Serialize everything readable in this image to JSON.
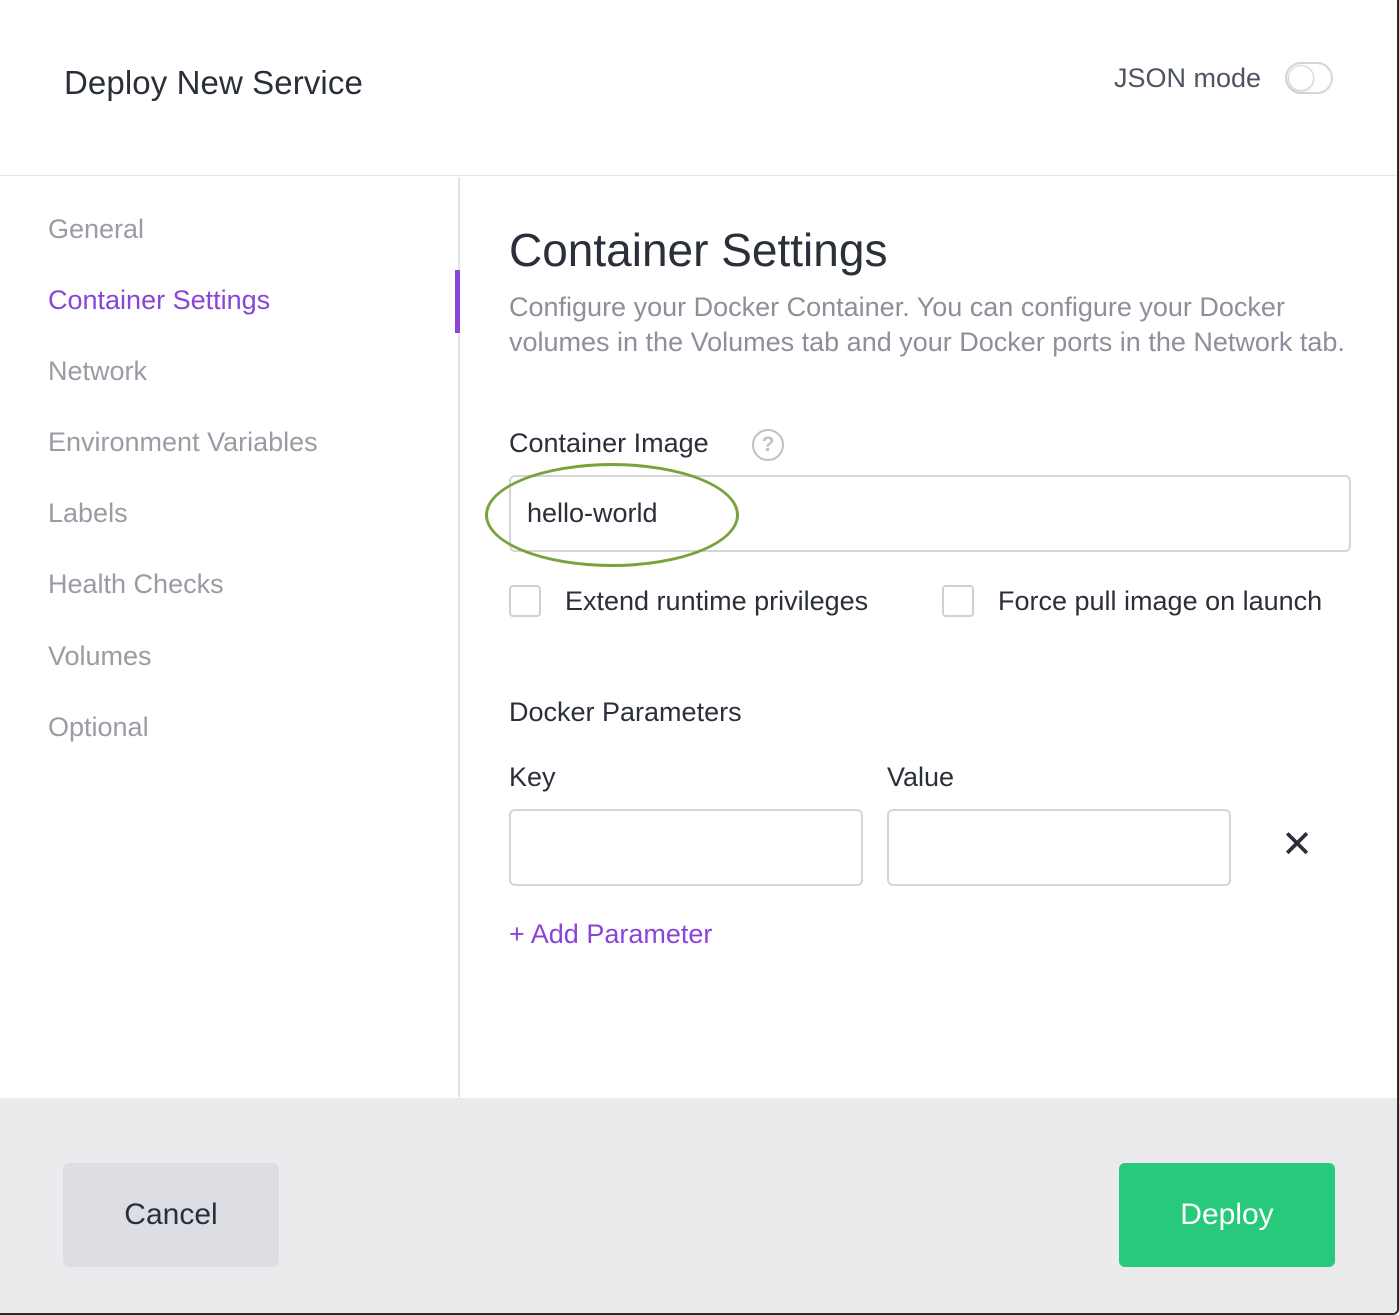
{
  "header": {
    "title": "Deploy New Service",
    "json_mode_label": "JSON mode",
    "json_mode_enabled": false
  },
  "sidebar": {
    "items": [
      {
        "label": "General",
        "active": false
      },
      {
        "label": "Container Settings",
        "active": true
      },
      {
        "label": "Network",
        "active": false
      },
      {
        "label": "Environment Variables",
        "active": false
      },
      {
        "label": "Labels",
        "active": false
      },
      {
        "label": "Health Checks",
        "active": false
      },
      {
        "label": "Volumes",
        "active": false
      },
      {
        "label": "Optional",
        "active": false
      }
    ]
  },
  "main": {
    "title": "Container Settings",
    "description": "Configure your Docker Container. You can configure your Docker volumes in the Volumes tab and your Docker ports in the Network tab.",
    "container_image": {
      "label": "Container Image",
      "help_icon": "?",
      "value": "hello-world"
    },
    "checkboxes": {
      "extend_runtime": {
        "label": "Extend runtime privileges",
        "checked": false
      },
      "force_pull": {
        "label": "Force pull image on launch",
        "checked": false
      }
    },
    "docker_parameters": {
      "title": "Docker Parameters",
      "key_label": "Key",
      "value_label": "Value",
      "key_value": "",
      "value_value": "",
      "remove_icon": "✕",
      "add_label": "+ Add Parameter"
    }
  },
  "footer": {
    "cancel_label": "Cancel",
    "deploy_label": "Deploy"
  },
  "colors": {
    "accent": "#8a44d8",
    "deploy": "#27c97a",
    "highlight": "#79a33a"
  }
}
